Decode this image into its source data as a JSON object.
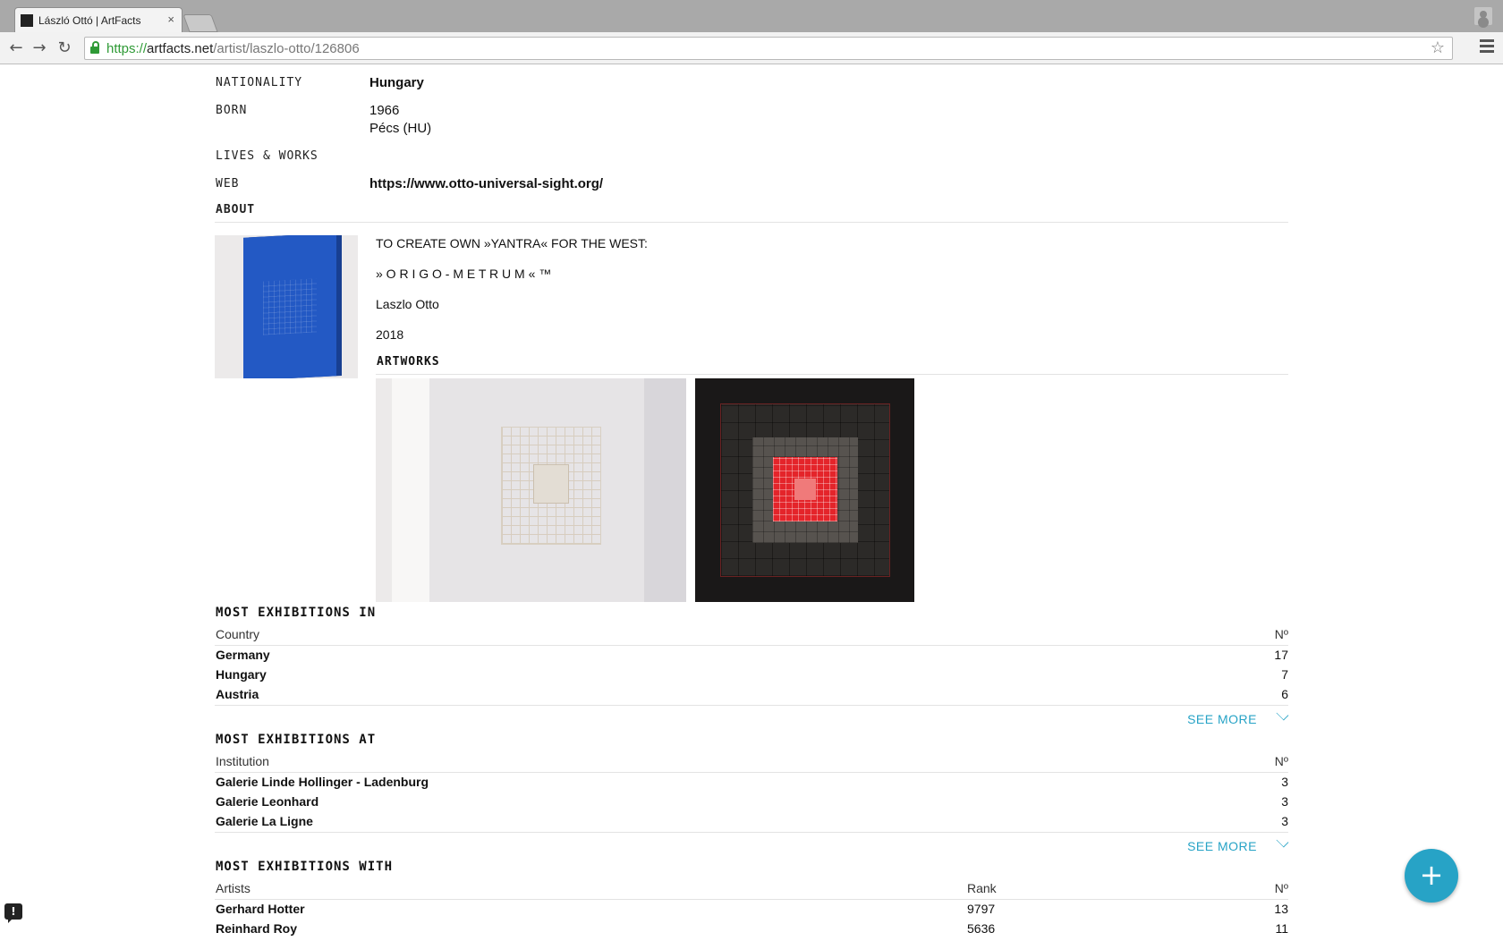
{
  "browser": {
    "tab_title": "László Ottó | ArtFacts",
    "tab_close": "×",
    "url_scheme": "https://",
    "url_host": "artfacts.net",
    "url_path": "/artist/laszlo-otto/126806"
  },
  "profile": {
    "nationality_label": "NATIONALITY",
    "nationality": "Hungary",
    "born_label": "BORN",
    "born_year": "1966",
    "born_place": "Pécs (HU)",
    "lives_label": "LIVES & WORKS",
    "web_label": "WEB",
    "web": "https://www.otto-universal-sight.org/",
    "about_label": "ABOUT"
  },
  "about": {
    "line1": "TO CREATE OWN  »YANTRA«  FOR THE WEST:",
    "line2": "» O R I G O - M E T R U M « ™",
    "line3": "Laszlo Otto",
    "line4": "2018"
  },
  "artworks": {
    "title": "ARTWORKS"
  },
  "exhibitions_in": {
    "title": "MOST EXHIBITIONS IN",
    "col_name": "Country",
    "col_num": "Nº",
    "rows": [
      {
        "name": "Germany",
        "num": "17"
      },
      {
        "name": "Hungary",
        "num": "7"
      },
      {
        "name": "Austria",
        "num": "6"
      }
    ],
    "see_more": "SEE MORE"
  },
  "exhibitions_at": {
    "title": "MOST EXHIBITIONS AT",
    "col_name": "Institution",
    "col_num": "Nº",
    "rows": [
      {
        "name": "Galerie Linde Hollinger - Ladenburg",
        "num": "3"
      },
      {
        "name": "Galerie Leonhard",
        "num": "3"
      },
      {
        "name": "Galerie La Ligne",
        "num": "3"
      }
    ],
    "see_more": "SEE MORE"
  },
  "exhibitions_with": {
    "title": "MOST EXHIBITIONS WITH",
    "col_name": "Artists",
    "col_rank": "Rank",
    "col_num": "Nº",
    "rows": [
      {
        "name": "Gerhard Hotter",
        "rank": "9797",
        "num": "13"
      },
      {
        "name": "Reinhard Roy",
        "rank": "5636",
        "num": "11"
      }
    ]
  },
  "fab": {
    "icon": "plus-icon",
    "symbol": "+"
  },
  "feedback": {
    "icon": "feedback-icon",
    "symbol": "!"
  },
  "colors": {
    "accent": "#27a3c6",
    "secure": "#2f9a36"
  }
}
